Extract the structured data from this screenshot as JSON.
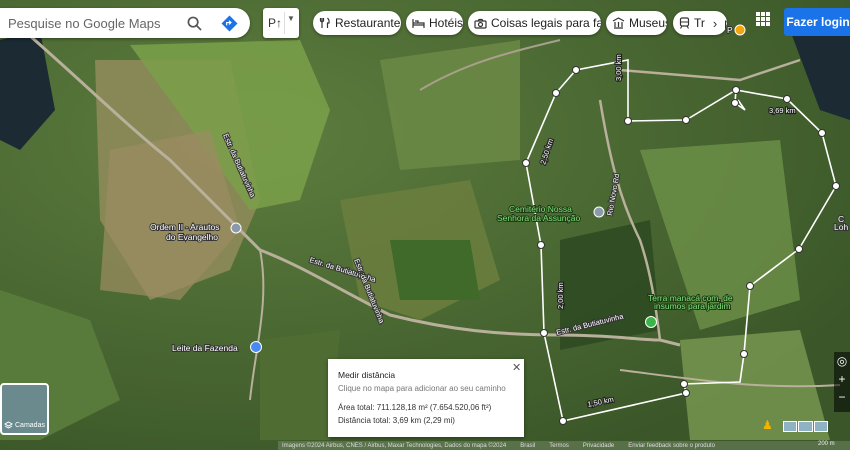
{
  "search": {
    "placeholder": "Pesquise no Google Maps"
  },
  "travel_mode": {
    "label": "P↑"
  },
  "categories": [
    {
      "label": "Restaurantes",
      "icon": "fork-knife-icon"
    },
    {
      "label": "Hotéis",
      "icon": "bed-icon"
    },
    {
      "label": "Coisas legais para fazer",
      "icon": "camera-icon"
    },
    {
      "label": "Museus",
      "icon": "museum-icon"
    },
    {
      "label": "Transporte público",
      "icon": "train-icon"
    }
  ],
  "login_label": "Fazer login",
  "places": {
    "ordem": "Ordem II - Arautos do Evangelho",
    "ordem_line1": "Ordem II - Arautos",
    "ordem_line2": "do Evangelho",
    "cemiterio_line1": "Cemitério Nossa",
    "cemiterio_line2": "Senhora da Assunção",
    "terra_line1": "Terra manacá com. de",
    "terra_line2": "insumos para jardim",
    "leite": "Leite da Fazenda",
    "right_edge_1": "C",
    "right_edge_2": "Loh",
    "top_right": "P"
  },
  "roads": {
    "butiatuvinha_a": "Estr. da Butiatuvinha",
    "butiatuvinha_b": "Estr. da Butiatuvinha",
    "butiatuvinha_c": "Estr. da Butiatuvinha",
    "butiatuvinha_d": "Estr. da Butiatuvinha",
    "rio_novo": "Rio Novo Rd"
  },
  "measure": {
    "title": "Medir distância",
    "hint": "Clique no mapa para adicionar ao seu caminho",
    "area": "Área total: 711.128,18 m² (7.654.520,06 ft²)",
    "distance": "Distância total: 3,69 km (2,29 mi)",
    "labels": [
      "3,00 km",
      "3,69 km",
      "2,50 km",
      "2,00 km",
      "1,50 km"
    ]
  },
  "layers_label": "Camadas",
  "attribution": [
    "Imagens ©2024 Airbus, CNES / Airbus, Maxar Technologies, Dados do mapa ©2024",
    "Brasil",
    "Termos",
    "Privacidade",
    "Enviar feedback sobre o produto"
  ],
  "scale_label": "200 m",
  "colors": {
    "accent": "#1a73e8",
    "place_green": "#7ee07a",
    "measure_line": "#ffffff",
    "place_label": "#ffffff"
  }
}
